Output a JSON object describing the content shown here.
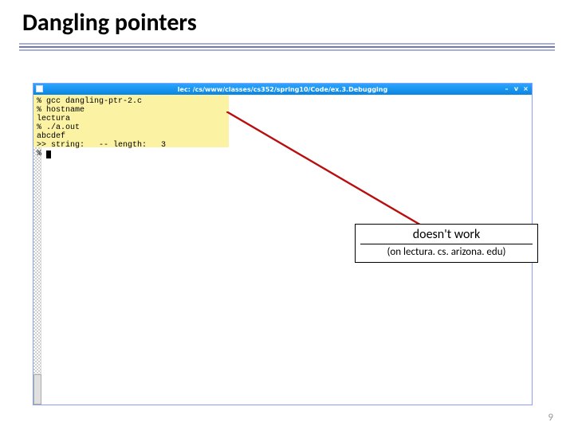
{
  "slide": {
    "title": "Dangling pointers",
    "page_number": "9"
  },
  "window": {
    "title": "lec: /cs/www/classes/cs352/spring10/Code/ex.3.Debugging",
    "buttons": {
      "min": "–",
      "mid": "v",
      "close": "×"
    }
  },
  "terminal": {
    "lines": [
      "% gcc dangling-ptr-2.c",
      "% hostname",
      "lectura",
      "% ./a.out",
      "abcdef",
      ">> string:   -- length:   3",
      "% "
    ]
  },
  "callout": {
    "line1": "doesn't work",
    "line2": "(on lectura. cs. arizona. edu)"
  }
}
